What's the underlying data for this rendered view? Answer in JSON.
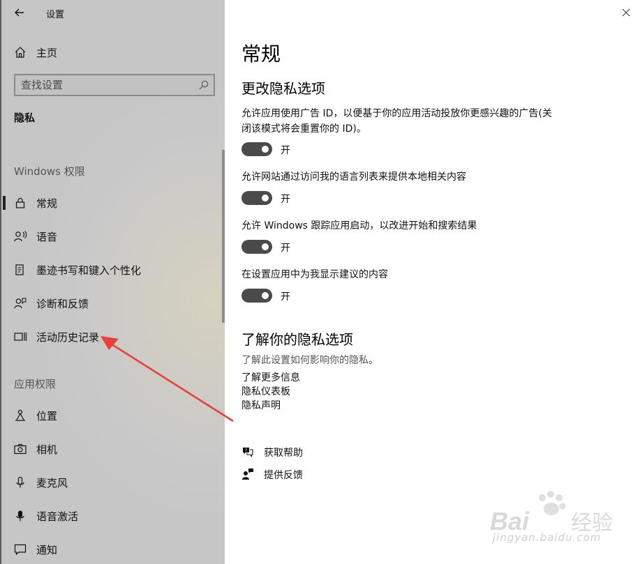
{
  "window": {
    "title": "设置"
  },
  "sidebar": {
    "home_label": "主页",
    "search_placeholder": "查找设置",
    "section_title": "隐私",
    "groups": [
      {
        "header": "Windows 权限",
        "items": [
          {
            "label": "常规",
            "icon": "lock-icon",
            "selected": true
          },
          {
            "label": "语音",
            "icon": "speech-icon"
          },
          {
            "label": "墨迹书写和键入个性化",
            "icon": "ink-icon"
          },
          {
            "label": "诊断和反馈",
            "icon": "diagnostics-icon"
          },
          {
            "label": "活动历史记录",
            "icon": "activity-history-icon"
          }
        ]
      },
      {
        "header": "应用权限",
        "items": [
          {
            "label": "位置",
            "icon": "location-icon"
          },
          {
            "label": "相机",
            "icon": "camera-icon"
          },
          {
            "label": "麦克风",
            "icon": "microphone-icon"
          },
          {
            "label": "语音激活",
            "icon": "voice-activation-icon"
          },
          {
            "label": "通知",
            "icon": "notification-icon"
          }
        ]
      }
    ]
  },
  "main": {
    "title": "常规",
    "subtitle": "更改隐私选项",
    "settings": [
      {
        "description": "允许应用使用广告 ID，以便基于你的应用活动投放你更感兴趣的广告(关闭该模式将会重置你的 ID)。",
        "state_label": "开",
        "on": true
      },
      {
        "description": "允许网站通过访问我的语言列表来提供本地相关内容",
        "state_label": "开",
        "on": true
      },
      {
        "description": "允许 Windows 跟踪应用启动，以改进开始和搜索结果",
        "state_label": "开",
        "on": true
      },
      {
        "description": "在设置应用中为我显示建议的内容",
        "state_label": "开",
        "on": true
      }
    ],
    "learn": {
      "heading": "了解你的隐私选项",
      "description": "了解此设置如何影响你的隐私。",
      "links": [
        "了解更多信息",
        "隐私仪表板",
        "隐私声明"
      ]
    },
    "help": {
      "get_help": "获取帮助",
      "feedback": "提供反馈"
    }
  },
  "watermark": {
    "brand": "Baidu经验",
    "url": "jingyan.baidu.com"
  },
  "colors": {
    "annotation_arrow": "#e8413a",
    "toggle_on": "#4a4a4a"
  }
}
